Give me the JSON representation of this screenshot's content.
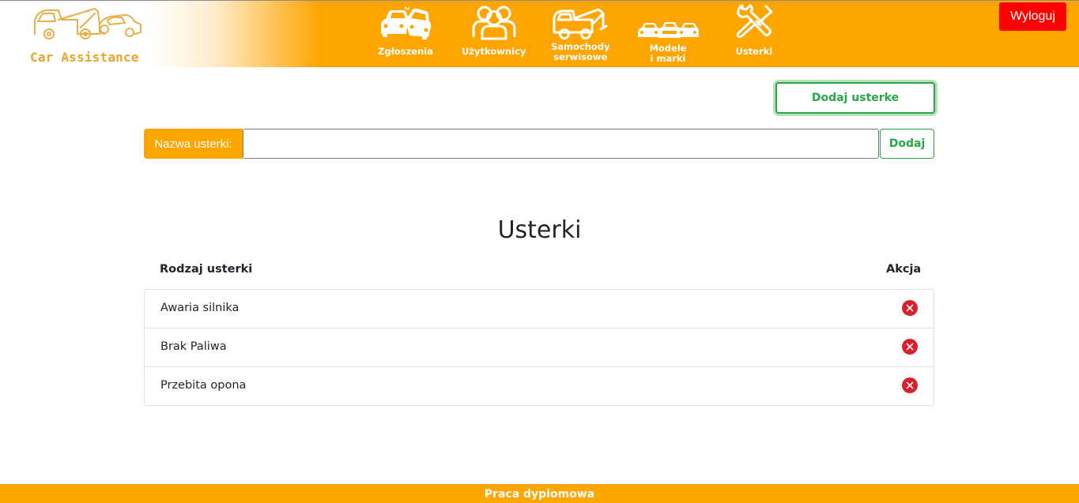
{
  "header": {
    "logo_text": "Car Assistance",
    "logout_label": "Wyloguj",
    "nav": [
      {
        "label": "Zgłoszenia",
        "icon": "crash-cars-icon"
      },
      {
        "label": "Użytkownicy",
        "icon": "users-icon"
      },
      {
        "label": "Samochody\nserwisowe",
        "icon": "tow-truck-icon"
      },
      {
        "label": "Modele\ni marki",
        "icon": "cars-icon"
      },
      {
        "label": "Usterki",
        "icon": "wrench-screwdriver-icon"
      }
    ]
  },
  "actions": {
    "add_fault_label": "Dodaj usterke"
  },
  "form": {
    "name_label": "Nazwa usterki:",
    "name_value": "",
    "submit_label": "Dodaj"
  },
  "main": {
    "title": "Usterki",
    "columns": [
      "Rodzaj usterki",
      "Akcja"
    ],
    "rows": [
      {
        "name": "Awaria silnika",
        "action_icon": "delete-icon"
      },
      {
        "name": "Brak Paliwa",
        "action_icon": "delete-icon"
      },
      {
        "name": "Przebita opona",
        "action_icon": "delete-icon"
      }
    ]
  },
  "footer": {
    "text": "Praca dyplomowa"
  },
  "colors": {
    "accent": "#ffa500",
    "danger": "#dc1f2e",
    "success": "#28a745",
    "logout": "#ff0000"
  }
}
